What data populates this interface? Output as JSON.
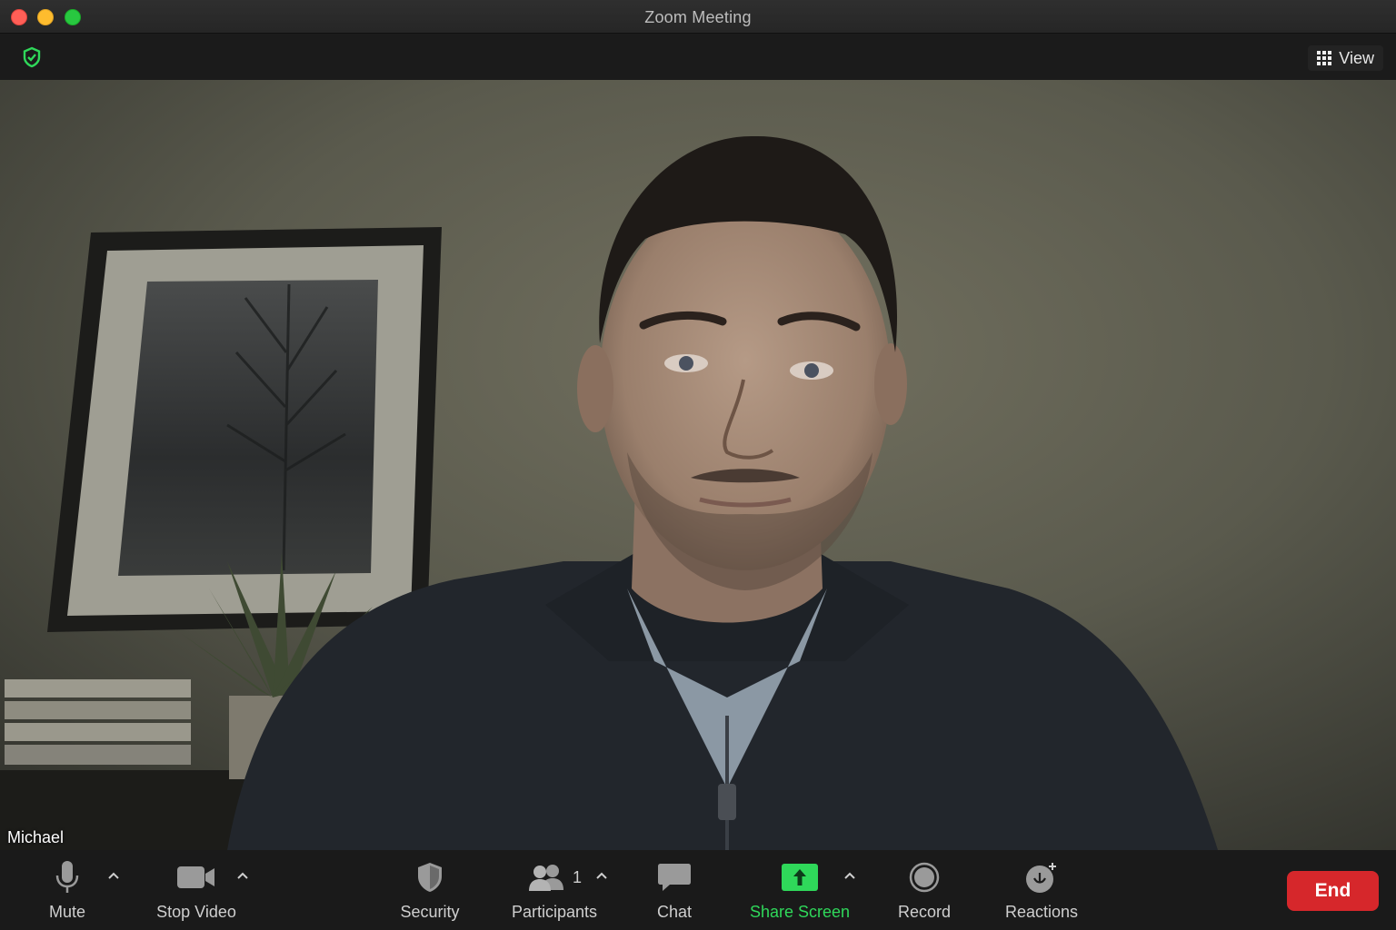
{
  "window": {
    "title": "Zoom Meeting"
  },
  "topbar": {
    "view_label": "View"
  },
  "video": {
    "participant_name": "Michael"
  },
  "toolbar": {
    "mute_label": "Mute",
    "stop_video_label": "Stop Video",
    "security_label": "Security",
    "participants_label": "Participants",
    "participants_count": "1",
    "chat_label": "Chat",
    "share_screen_label": "Share Screen",
    "record_label": "Record",
    "reactions_label": "Reactions",
    "end_label": "End"
  },
  "colors": {
    "accent_green": "#2fd85a",
    "end_red": "#d6272b"
  },
  "icons": [
    "shield-icon",
    "grid-icon",
    "microphone-icon",
    "video-camera-icon",
    "security-shield-icon",
    "participants-icon",
    "chat-icon",
    "share-screen-icon",
    "record-icon",
    "reactions-icon"
  ]
}
